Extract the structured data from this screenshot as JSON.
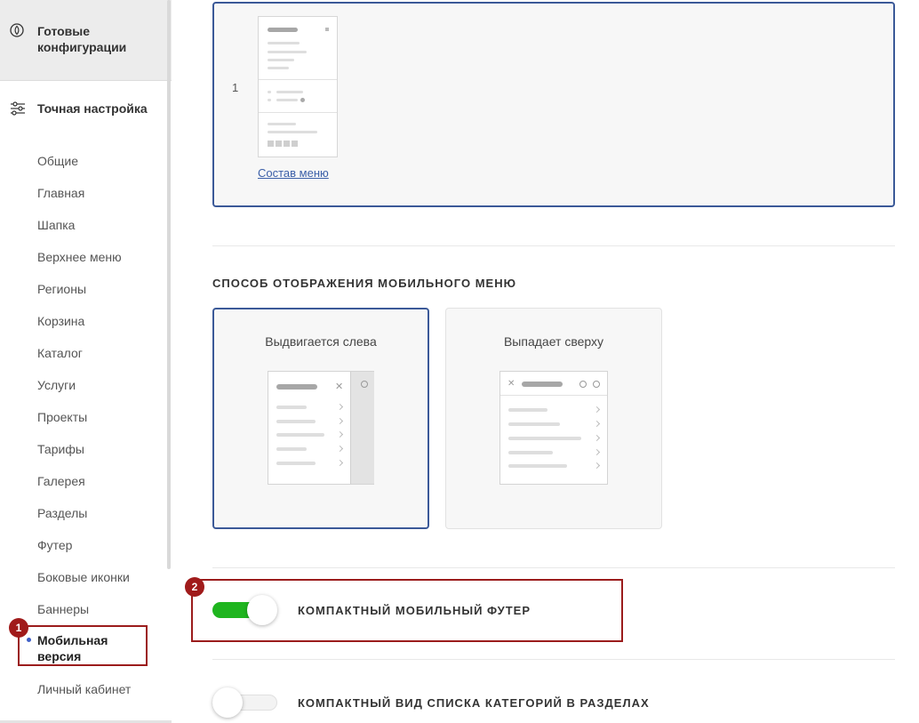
{
  "sidebar": {
    "ready_configs": "Готовые конфигурации",
    "fine_tuning": "Точная настройка",
    "items": [
      "Общие",
      "Главная",
      "Шапка",
      "Верхнее меню",
      "Регионы",
      "Корзина",
      "Каталог",
      "Услуги",
      "Проекты",
      "Тарифы",
      "Галерея",
      "Разделы",
      "Футер",
      "Боковые иконки",
      "Баннеры"
    ],
    "active_item": "Мобильная версия",
    "after_item": "Личный кабинет"
  },
  "menu_block": {
    "number": "1",
    "link_label": "Состав меню"
  },
  "mobile_menu": {
    "title": "СПОСОБ ОТОБРАЖЕНИЯ МОБИЛЬНОГО МЕНЮ",
    "options": [
      "Выдвигается слева",
      "Выпадает сверху"
    ],
    "selected": "Выдвигается слева"
  },
  "toggles": [
    {
      "label": "КОМПАКТНЫЙ МОБИЛЬНЫЙ ФУТЕР",
      "on": true
    },
    {
      "label": "КОМПАКТНЫЙ ВИД СПИСКА КАТЕГОРИЙ В РАЗДЕЛАХ",
      "on": false
    }
  ],
  "annotations": [
    "1",
    "2"
  ],
  "colors": {
    "accent": "#3b5998",
    "toggle_on": "#1fb51f",
    "annotation": "#9b1c1c"
  }
}
